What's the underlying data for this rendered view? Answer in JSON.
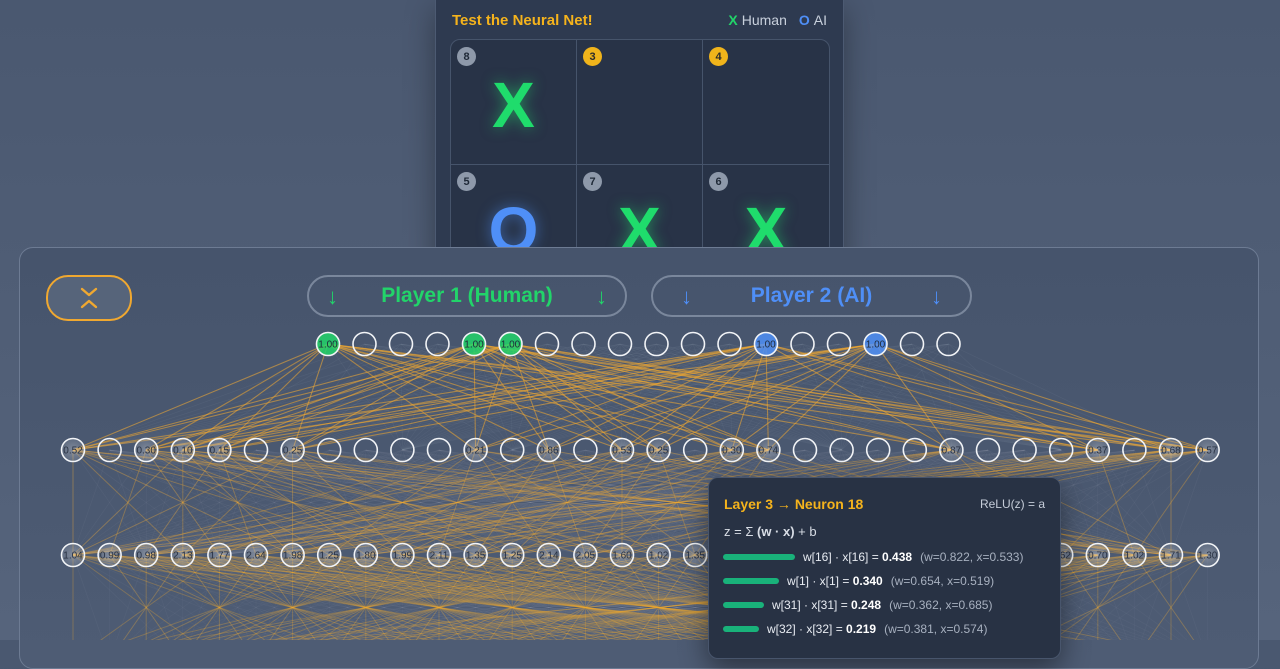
{
  "board": {
    "title": "Test the Neural Net!",
    "legend_human_mark": "X",
    "legend_human": "Human",
    "legend_ai_mark": "O",
    "legend_ai": "AI",
    "cells": [
      {
        "num": "8",
        "piece": "X",
        "highlight": false
      },
      {
        "num": "3",
        "piece": "",
        "highlight": true
      },
      {
        "num": "4",
        "piece": "",
        "highlight": true
      },
      {
        "num": "5",
        "piece": "O",
        "highlight": false
      },
      {
        "num": "7",
        "piece": "X",
        "highlight": false
      },
      {
        "num": "6",
        "piece": "X",
        "highlight": false
      }
    ]
  },
  "network": {
    "player1_label": "Player 1 (Human)",
    "player2_label": "Player 2 (AI)",
    "arrow_glyph": "↓",
    "colors": {
      "human": "#22d46a",
      "ai": "#4f8ff7",
      "accent": "#f5b31c",
      "weight_bar": "#19b27a"
    },
    "input_layer": [
      "1.00",
      "",
      "",
      "",
      "1.00",
      "1.00",
      "",
      "",
      "",
      "",
      "",
      "",
      "1.00",
      "",
      "",
      "1.00",
      "",
      ""
    ],
    "input_owner": [
      "human",
      "",
      "",
      "",
      "human",
      "human",
      "",
      "",
      "",
      "",
      "",
      "",
      "ai",
      "",
      "",
      "ai",
      "",
      ""
    ],
    "hidden_layer_1": [
      "0.52",
      "",
      "0.30",
      "0.10",
      "0.15",
      "",
      "0.25",
      "",
      "",
      "",
      "",
      "0.21",
      "",
      "0.86",
      "",
      "0.53",
      "0.25",
      "",
      "0.30",
      "0.74",
      "",
      "",
      "",
      "",
      "0.87",
      "",
      "",
      "",
      "0.37",
      "",
      "0.68",
      "0.57"
    ],
    "hidden_layer_2": [
      "1.04",
      "0.99",
      "0.98",
      "2.13",
      "1.77",
      "2.64",
      "1.98",
      "1.25",
      "1.80",
      "1.99",
      "2.11",
      "1.35",
      "1.25",
      "2.14",
      "2.05",
      "1.60",
      "1.02",
      "1.35",
      "",
      "",
      "",
      "",
      "",
      "",
      "",
      "",
      "",
      "1.62",
      "0.70",
      "1.02",
      "1.71",
      "1.30"
    ]
  },
  "tooltip": {
    "title": "Layer 3 → Neuron 18",
    "activation": "ReLU(z) = a",
    "formula_z": "z = Σ",
    "formula_wx": "(w · x)",
    "formula_b": "+ b",
    "rows": [
      {
        "bar": 0.438,
        "term": "w[16] · x[16] = ",
        "value": "0.438",
        "detail": "(w=0.822, x=0.533)"
      },
      {
        "bar": 0.34,
        "term": "w[1] · x[1] = ",
        "value": "0.340",
        "detail": "(w=0.654, x=0.519)"
      },
      {
        "bar": 0.248,
        "term": "w[31] · x[31] = ",
        "value": "0.248",
        "detail": "(w=0.362, x=0.685)"
      },
      {
        "bar": 0.219,
        "term": "w[32] · x[32] = ",
        "value": "0.219",
        "detail": "(w=0.381, x=0.574)"
      }
    ]
  }
}
